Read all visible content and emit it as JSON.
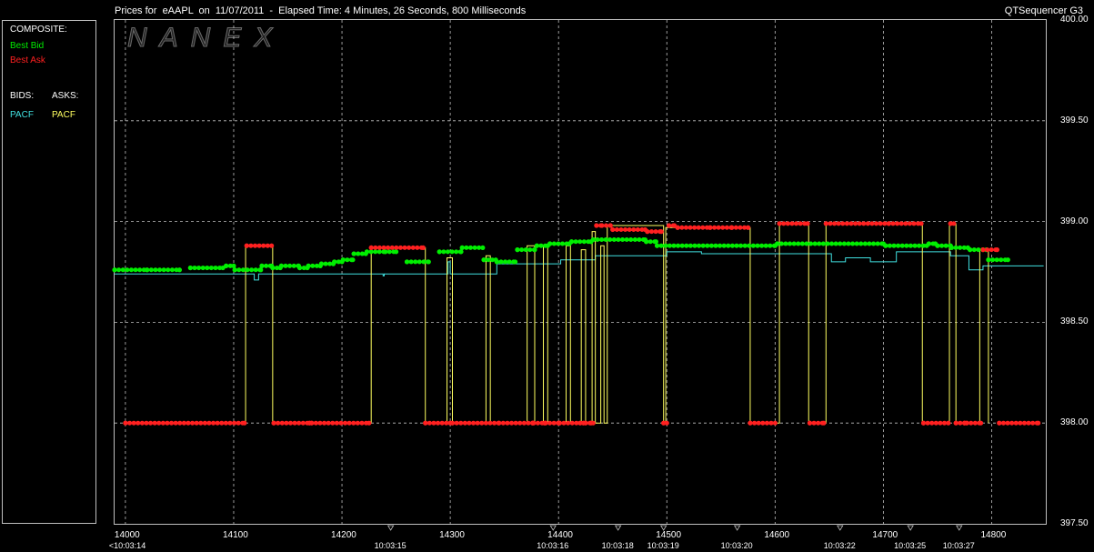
{
  "header": {
    "title": "Prices for  eAAPL  on  11/07/2011  -  Elapsed Time: 4 Minutes, 26 Seconds, 800 Milliseconds",
    "app": "QTSequencer G3"
  },
  "watermark": "NANEX",
  "legend": {
    "composite_label": "COMPOSITE:",
    "best_bid": "Best Bid",
    "best_ask": "Best Ask",
    "bids_label": "BIDS:",
    "asks_label": "ASKS:",
    "bid_exchange": "PACF",
    "ask_exchange": "PACF"
  },
  "colors": {
    "best_bid": "#00ee00",
    "best_ask": "#ff2020",
    "bid_exchange": "#40e0e0",
    "ask_exchange": "#ffff60",
    "grid": "#bfbfbf"
  },
  "chart_data": {
    "type": "line",
    "ylim": [
      397.5,
      400.0
    ],
    "xlim": [
      13990,
      14850
    ],
    "y_ticks": [
      "400.00",
      "399.50",
      "399.00",
      "398.50",
      "398.00",
      "397.50"
    ],
    "x_ticks": [
      "14000",
      "14100",
      "14200",
      "14300",
      "14400",
      "14500",
      "14600",
      "14700",
      "14800"
    ],
    "time_labels": [
      {
        "x": 14000,
        "text": "<10:03:14"
      },
      {
        "x": 14245,
        "text": "10:03:15"
      },
      {
        "x": 14395,
        "text": "10:03:16"
      },
      {
        "x": 14455,
        "text": "10:03:18"
      },
      {
        "x": 14497,
        "text": "10:03:19"
      },
      {
        "x": 14565,
        "text": "10:03:20"
      },
      {
        "x": 14660,
        "text": "10:03:22"
      },
      {
        "x": 14725,
        "text": "10:03:25"
      },
      {
        "x": 14770,
        "text": "10:03:27"
      }
    ],
    "series": [
      {
        "name": "Best Bid",
        "style": "dots",
        "points": [
          [
            13990,
            398.76
          ],
          [
            14020,
            398.76
          ],
          [
            14050,
            398.76
          ],
          [
            14060,
            398.77
          ],
          [
            14090,
            398.77
          ],
          [
            14093,
            398.78
          ],
          [
            14100,
            398.78
          ],
          [
            14101,
            398.76
          ],
          [
            14125,
            398.76
          ],
          [
            14126,
            398.78
          ],
          [
            14135,
            398.78
          ],
          [
            14136,
            398.77
          ],
          [
            14143,
            398.77
          ],
          [
            14144,
            398.78
          ],
          [
            14160,
            398.78
          ],
          [
            14161,
            398.77
          ],
          [
            14168,
            398.77
          ],
          [
            14169,
            398.78
          ],
          [
            14180,
            398.78
          ],
          [
            14181,
            398.79
          ],
          [
            14192,
            398.79
          ],
          [
            14193,
            398.8
          ],
          [
            14200,
            398.8
          ],
          [
            14201,
            398.81
          ],
          [
            14210,
            398.81
          ],
          [
            14211,
            398.84
          ],
          [
            14222,
            398.84
          ],
          [
            14223,
            398.85
          ],
          [
            14240,
            398.85
          ],
          [
            14250,
            398.85
          ],
          [
            14260,
            398.8
          ],
          [
            14280,
            398.8
          ],
          [
            14290,
            398.85
          ],
          [
            14310,
            398.85
          ],
          [
            14311,
            398.87
          ],
          [
            14330,
            398.87
          ],
          [
            14331,
            398.81
          ],
          [
            14342,
            398.81
          ],
          [
            14343,
            398.8
          ],
          [
            14360,
            398.8
          ],
          [
            14362,
            398.86
          ],
          [
            14378,
            398.86
          ],
          [
            14380,
            398.88
          ],
          [
            14390,
            398.88
          ],
          [
            14392,
            398.89
          ],
          [
            14410,
            398.89
          ],
          [
            14412,
            398.9
          ],
          [
            14430,
            398.9
          ],
          [
            14432,
            398.91
          ],
          [
            14480,
            398.91
          ],
          [
            14481,
            398.9
          ],
          [
            14490,
            398.9
          ],
          [
            14491,
            398.88
          ],
          [
            14600,
            398.88
          ],
          [
            14602,
            398.89
          ],
          [
            14700,
            398.89
          ],
          [
            14702,
            398.88
          ],
          [
            14740,
            398.88
          ],
          [
            14742,
            398.89
          ],
          [
            14748,
            398.89
          ],
          [
            14750,
            398.88
          ],
          [
            14762,
            398.88
          ],
          [
            14763,
            398.87
          ],
          [
            14778,
            398.87
          ],
          [
            14780,
            398.86
          ],
          [
            14795,
            398.86
          ],
          [
            14797,
            398.81
          ],
          [
            14815,
            398.81
          ]
        ]
      },
      {
        "name": "Best Ask",
        "style": "dots",
        "points": [
          [
            14000,
            398.0
          ],
          [
            14110,
            398.0
          ],
          [
            14112,
            398.88
          ],
          [
            14135,
            398.88
          ],
          [
            14137,
            398.0
          ],
          [
            14170,
            398.0
          ],
          [
            14172,
            398.0
          ],
          [
            14225,
            398.0
          ],
          [
            14227,
            398.87
          ],
          [
            14275,
            398.87
          ],
          [
            14277,
            398.0
          ],
          [
            14300,
            398.0
          ],
          [
            14302,
            398.0
          ],
          [
            14345,
            398.0
          ],
          [
            14376,
            398.0
          ],
          [
            14377,
            398.0
          ],
          [
            14387,
            398.0
          ],
          [
            14388,
            398.0
          ],
          [
            14400,
            398.0
          ],
          [
            14401,
            398.0
          ],
          [
            14420,
            398.0
          ],
          [
            14423,
            398.0
          ],
          [
            14425,
            398.0
          ],
          [
            14430,
            398.0
          ],
          [
            14432,
            398.0
          ],
          [
            14435,
            398.98
          ],
          [
            14440,
            398.98
          ],
          [
            14448,
            398.98
          ],
          [
            14450,
            398.96
          ],
          [
            14480,
            398.96
          ],
          [
            14482,
            398.95
          ],
          [
            14495,
            398.95
          ],
          [
            14497,
            398.0
          ],
          [
            14500,
            398.0
          ],
          [
            14502,
            398.98
          ],
          [
            14507,
            398.98
          ],
          [
            14510,
            398.97
          ],
          [
            14540,
            398.97
          ],
          [
            14560,
            398.97
          ],
          [
            14575,
            398.97
          ],
          [
            14577,
            398.0
          ],
          [
            14600,
            398.0
          ],
          [
            14604,
            398.99
          ],
          [
            14630,
            398.99
          ],
          [
            14632,
            398.0
          ],
          [
            14645,
            398.0
          ],
          [
            14647,
            398.99
          ],
          [
            14705,
            398.99
          ],
          [
            14735,
            398.99
          ],
          [
            14737,
            398.0
          ],
          [
            14760,
            398.0
          ],
          [
            14762,
            398.99
          ],
          [
            14765,
            398.99
          ],
          [
            14767,
            398.0
          ],
          [
            14775,
            398.0
          ],
          [
            14777,
            398.0
          ],
          [
            14790,
            398.0
          ],
          [
            14792,
            398.86
          ],
          [
            14805,
            398.86
          ],
          [
            14807,
            398.0
          ],
          [
            14843,
            398.0
          ]
        ]
      },
      {
        "name": "PACF",
        "role": "bid",
        "style": "step",
        "points": [
          [
            13990,
            398.74
          ],
          [
            14118,
            398.74
          ],
          [
            14119,
            398.71
          ],
          [
            14123,
            398.74
          ],
          [
            14237,
            398.74
          ],
          [
            14238,
            398.73
          ],
          [
            14239,
            398.74
          ],
          [
            14295,
            398.74
          ],
          [
            14298,
            398.8
          ],
          [
            14300,
            398.74
          ],
          [
            14340,
            398.74
          ],
          [
            14343,
            398.79
          ],
          [
            14400,
            398.79
          ],
          [
            14402,
            398.81
          ],
          [
            14432,
            398.81
          ],
          [
            14434,
            398.83
          ],
          [
            14495,
            398.83
          ],
          [
            14500,
            398.85
          ],
          [
            14530,
            398.85
          ],
          [
            14532,
            398.84
          ],
          [
            14600,
            398.84
          ],
          [
            14650,
            398.84
          ],
          [
            14652,
            398.8
          ],
          [
            14660,
            398.8
          ],
          [
            14665,
            398.82
          ],
          [
            14685,
            398.82
          ],
          [
            14688,
            398.8
          ],
          [
            14708,
            398.8
          ],
          [
            14712,
            398.85
          ],
          [
            14760,
            398.85
          ],
          [
            14762,
            398.83
          ],
          [
            14775,
            398.83
          ],
          [
            14779,
            398.76
          ],
          [
            14790,
            398.76
          ],
          [
            14792,
            398.78
          ],
          [
            14848,
            398.78
          ]
        ]
      },
      {
        "name": "PACF",
        "role": "ask",
        "style": "step",
        "points": [
          [
            14000,
            398.0
          ],
          [
            14110,
            398.0
          ],
          [
            14111,
            398.88
          ],
          [
            14135,
            398.88
          ],
          [
            14136,
            398.0
          ],
          [
            14226,
            398.0
          ],
          [
            14227,
            398.87
          ],
          [
            14276,
            398.87
          ],
          [
            14277,
            398.0
          ],
          [
            14296,
            398.0
          ],
          [
            14297,
            398.82
          ],
          [
            14301,
            398.82
          ],
          [
            14302,
            398.0
          ],
          [
            14332,
            398.0
          ],
          [
            14333,
            398.83
          ],
          [
            14336,
            398.83
          ],
          [
            14337,
            398.0
          ],
          [
            14370,
            398.0
          ],
          [
            14371,
            398.88
          ],
          [
            14377,
            398.88
          ],
          [
            14378,
            398.0
          ],
          [
            14385,
            398.0
          ],
          [
            14386,
            398.88
          ],
          [
            14389,
            398.88
          ],
          [
            14390,
            398.0
          ],
          [
            14406,
            398.0
          ],
          [
            14407,
            398.88
          ],
          [
            14410,
            398.88
          ],
          [
            14411,
            398.0
          ],
          [
            14420,
            398.0
          ],
          [
            14421,
            398.86
          ],
          [
            14424,
            398.86
          ],
          [
            14425,
            398.0
          ],
          [
            14430,
            398.0
          ],
          [
            14431,
            398.95
          ],
          [
            14433,
            398.95
          ],
          [
            14434,
            398.0
          ],
          [
            14438,
            398.0
          ],
          [
            14439,
            398.88
          ],
          [
            14441,
            398.88
          ],
          [
            14442,
            398.0
          ],
          [
            14444,
            398.0
          ],
          [
            14445,
            398.98
          ],
          [
            14496,
            398.98
          ],
          [
            14497,
            398.0
          ],
          [
            14498,
            398.0
          ],
          [
            14499,
            398.97
          ],
          [
            14576,
            398.97
          ],
          [
            14577,
            398.0
          ],
          [
            14603,
            398.0
          ],
          [
            14604,
            398.99
          ],
          [
            14630,
            398.99
          ],
          [
            14631,
            398.0
          ],
          [
            14646,
            398.0
          ],
          [
            14647,
            398.99
          ],
          [
            14735,
            398.99
          ],
          [
            14736,
            398.0
          ],
          [
            14760,
            398.0
          ],
          [
            14761,
            398.99
          ],
          [
            14766,
            398.99
          ],
          [
            14767,
            398.0
          ],
          [
            14788,
            398.0
          ],
          [
            14789,
            398.86
          ],
          [
            14796,
            398.86
          ],
          [
            14797,
            398.0
          ]
        ]
      }
    ]
  }
}
